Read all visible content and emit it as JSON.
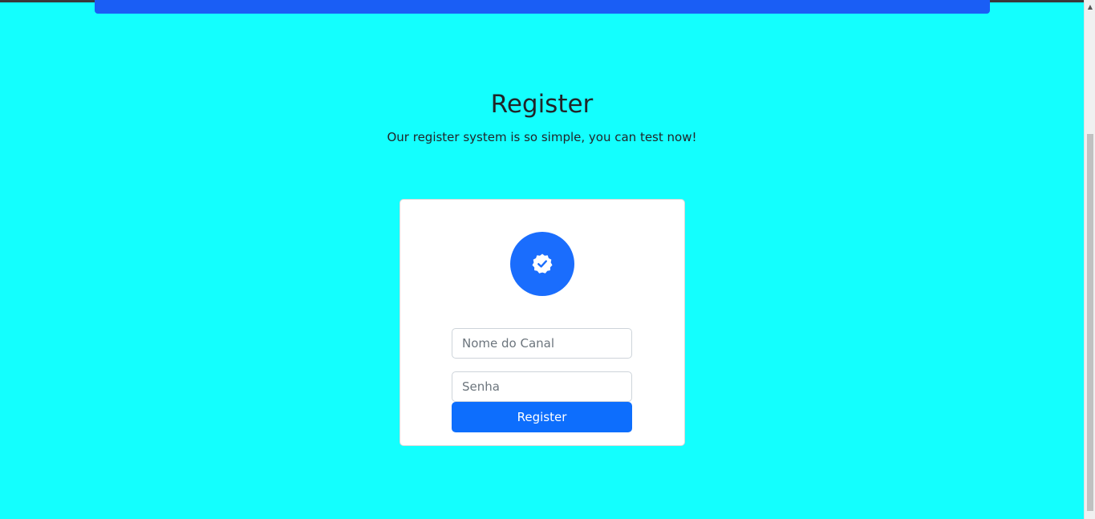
{
  "page": {
    "title": "Register",
    "subtitle": "Our register system is so simple, you can test now!"
  },
  "form": {
    "icon": "patch-check-icon",
    "channel_name_placeholder": "Nome do Canal",
    "channel_name_value": "",
    "password_placeholder": "Senha",
    "password_value": "",
    "submit_label": "Register"
  },
  "colors": {
    "background": "#13fffe",
    "primary": "#0d6efd",
    "top_bar": "#1a5ef5"
  }
}
